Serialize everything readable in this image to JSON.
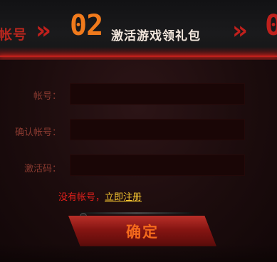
{
  "header": {
    "prev_step_label": "帐号",
    "chevrons": "»",
    "step_number": "02",
    "step_title": "激活游戏领礼包",
    "next_step_number": "0"
  },
  "form": {
    "account_label": "帐号：",
    "confirm_account_label": "确认帐号：",
    "activation_code_label": "激活码：",
    "account_value": "",
    "confirm_account_value": "",
    "activation_code_value": ""
  },
  "register": {
    "prompt": "没有帐号，",
    "link_text": "立即注册"
  },
  "confirm_button": {
    "label": "确定"
  },
  "colors": {
    "accent_orange": "#f07a1c",
    "accent_red": "#c0201c",
    "link_yellow": "#f4c430"
  }
}
